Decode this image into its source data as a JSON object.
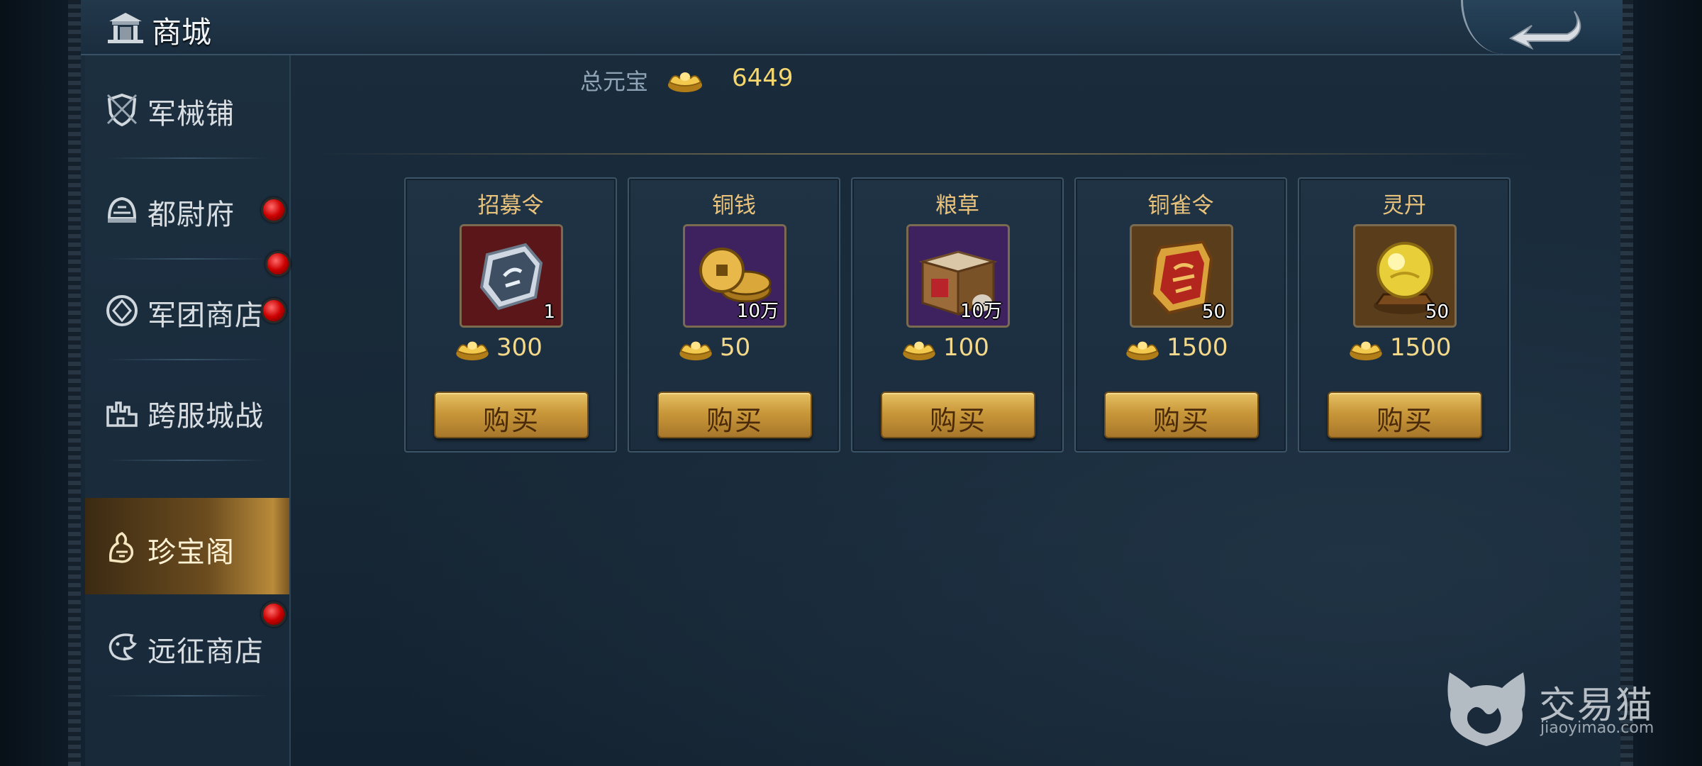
{
  "header": {
    "title": "商城"
  },
  "sidebar": {
    "items": [
      {
        "label": "军械铺",
        "icon": "shield-icon",
        "active": false,
        "badge": false
      },
      {
        "label": "都尉府",
        "icon": "helmet-icon",
        "active": false,
        "badge": true
      },
      {
        "label": "军团商店",
        "icon": "emblem-icon",
        "active": false,
        "badge": true
      },
      {
        "label": "跨服城战",
        "icon": "castle-icon",
        "active": false,
        "badge": false
      },
      {
        "label": "珍宝阁",
        "icon": "treasure-icon",
        "active": true,
        "badge": false
      },
      {
        "label": "远征商店",
        "icon": "dragon-icon",
        "active": false,
        "badge": true
      }
    ]
  },
  "currency": {
    "label": "总元宝",
    "value": "6449",
    "icon": "gold-ingot-icon"
  },
  "shop": {
    "buy_label": "购买",
    "items": [
      {
        "name": "招募令",
        "qty": "1",
        "price": "300",
        "icon": "recruit-token-icon"
      },
      {
        "name": "铜钱",
        "qty": "10万",
        "price": "50",
        "icon": "copper-coins-icon"
      },
      {
        "name": "粮草",
        "qty": "10万",
        "price": "100",
        "icon": "grain-crate-icon"
      },
      {
        "name": "铜雀令",
        "qty": "50",
        "price": "1500",
        "icon": "bronze-sparrow-token-icon"
      },
      {
        "name": "灵丹",
        "qty": "50",
        "price": "1500",
        "icon": "elixir-orb-icon"
      }
    ]
  },
  "watermark": {
    "text": "交易猫",
    "sub": "jiaoyimao.com"
  },
  "colors": {
    "accent_gold": "#e9c37b",
    "currency_gold": "#f5d76e",
    "badge_red": "#cc0000"
  }
}
